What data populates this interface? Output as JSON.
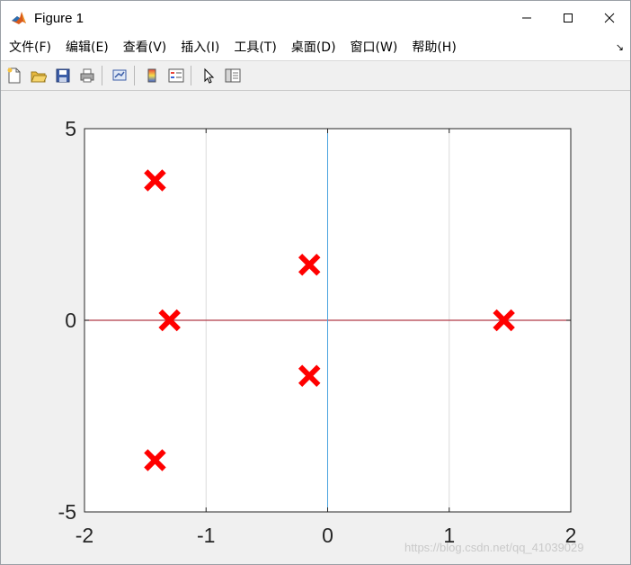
{
  "window": {
    "title": "Figure 1",
    "minimize_glyph": "—",
    "maximize_glyph": "☐",
    "close_glyph": "✕"
  },
  "menubar": {
    "items": [
      {
        "name": "menu-file",
        "label": "文件(F)"
      },
      {
        "name": "menu-edit",
        "label": "编辑(E)"
      },
      {
        "name": "menu-view",
        "label": "查看(V)"
      },
      {
        "name": "menu-insert",
        "label": "插入(I)"
      },
      {
        "name": "menu-tools",
        "label": "工具(T)"
      },
      {
        "name": "menu-desktop",
        "label": "桌面(D)"
      },
      {
        "name": "menu-window",
        "label": "窗口(W)"
      },
      {
        "name": "menu-help",
        "label": "帮助(H)"
      }
    ],
    "dock_glyph": "↘"
  },
  "toolbar": {
    "buttons": [
      {
        "name": "new-figure-icon"
      },
      {
        "name": "open-file-icon"
      },
      {
        "name": "save-figure-icon"
      },
      {
        "name": "print-figure-icon"
      },
      {
        "name": "link-plot-icon"
      },
      {
        "name": "insert-colorbar-icon"
      },
      {
        "name": "insert-legend-icon"
      },
      {
        "name": "edit-plot-cursor-icon"
      },
      {
        "name": "show-plot-tools-icon"
      }
    ]
  },
  "chart_data": {
    "type": "scatter",
    "marker": "x",
    "marker_color": "#ff0000",
    "xlim": [
      -2,
      2
    ],
    "ylim": [
      -5,
      5
    ],
    "xticks": [
      -2,
      -1,
      0,
      1,
      2
    ],
    "yticks": [
      -5,
      0,
      5
    ],
    "grid": "x",
    "points": [
      {
        "x": -1.42,
        "y": 3.65
      },
      {
        "x": -1.42,
        "y": -3.65
      },
      {
        "x": -1.3,
        "y": 0
      },
      {
        "x": -0.15,
        "y": 1.45
      },
      {
        "x": -0.15,
        "y": -1.45
      },
      {
        "x": 1.45,
        "y": 0
      }
    ],
    "reference_lines": [
      {
        "orientation": "horizontal",
        "value": 0,
        "color": "#b03a48"
      },
      {
        "orientation": "vertical",
        "value": 0,
        "color": "#4aa3df"
      }
    ]
  },
  "watermark": "https://blog.csdn.net/qq_41039029"
}
